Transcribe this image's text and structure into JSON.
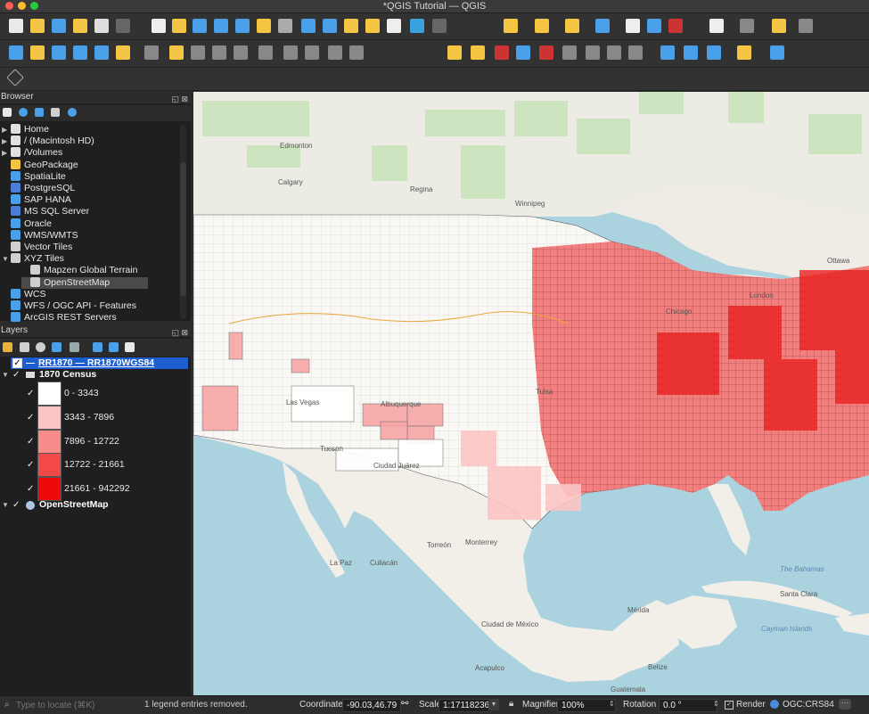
{
  "window": {
    "title": "*QGIS Tutorial — QGIS"
  },
  "browser": {
    "title": "Browser",
    "items": [
      {
        "label": "Home",
        "icon": "folder-home-icon"
      },
      {
        "label": "/ (Macintosh HD)",
        "icon": "folder-icon"
      },
      {
        "label": "/Volumes",
        "icon": "folder-icon"
      },
      {
        "label": "GeoPackage",
        "icon": "geopackage-icon"
      },
      {
        "label": "SpatiaLite",
        "icon": "spatialite-icon"
      },
      {
        "label": "PostgreSQL",
        "icon": "postgresql-icon"
      },
      {
        "label": "SAP HANA",
        "icon": "sap-hana-icon"
      },
      {
        "label": "MS SQL Server",
        "icon": "mssql-icon"
      },
      {
        "label": "Oracle",
        "icon": "oracle-icon"
      },
      {
        "label": "WMS/WMTS",
        "icon": "wms-icon"
      },
      {
        "label": "Vector Tiles",
        "icon": "vector-tiles-icon"
      },
      {
        "label": "XYZ Tiles",
        "icon": "xyz-tiles-icon"
      },
      {
        "label": "Mapzen Global Terrain",
        "icon": "tile-layer-icon"
      },
      {
        "label": "OpenStreetMap",
        "icon": "tile-layer-icon"
      },
      {
        "label": "WCS",
        "icon": "wcs-icon"
      },
      {
        "label": "WFS / OGC API - Features",
        "icon": "wfs-icon"
      },
      {
        "label": "ArcGIS REST Servers",
        "icon": "arcgis-icon"
      }
    ]
  },
  "layers": {
    "title": "Layers",
    "rr_layer": "RR1870 — RR1870WGS84",
    "census_layer": "1870 Census",
    "osm_layer": "OpenStreetMap",
    "legend": [
      {
        "label": "0 - 3343",
        "color": "#ffffff"
      },
      {
        "label": "3343 - 7896",
        "color": "#fbc4c4"
      },
      {
        "label": "7896 - 12722",
        "color": "#f88a8a"
      },
      {
        "label": "12722 - 21661",
        "color": "#f34848"
      },
      {
        "label": "21661 - 942292",
        "color": "#ee0a0a"
      }
    ]
  },
  "map": {
    "places": [
      {
        "name": "Edmonton",
        "kind": "city"
      },
      {
        "name": "Calgary",
        "kind": "city"
      },
      {
        "name": "Regina",
        "kind": "city"
      },
      {
        "name": "Winnipeg",
        "kind": "city"
      },
      {
        "name": "Ottawa",
        "kind": "city"
      },
      {
        "name": "London",
        "kind": "city"
      },
      {
        "name": "Chicago",
        "kind": "city"
      },
      {
        "name": "Las Vegas",
        "kind": "city"
      },
      {
        "name": "Albuquerque",
        "kind": "city"
      },
      {
        "name": "Tucson",
        "kind": "city"
      },
      {
        "name": "Ciudad Juárez",
        "kind": "city"
      },
      {
        "name": "Tulsa",
        "kind": "city"
      },
      {
        "name": "Monterrey",
        "kind": "city"
      },
      {
        "name": "Torreón",
        "kind": "city"
      },
      {
        "name": "Culiacán",
        "kind": "city"
      },
      {
        "name": "La Paz",
        "kind": "city"
      },
      {
        "name": "Ciudad de México",
        "kind": "city"
      },
      {
        "name": "Acapulco",
        "kind": "city"
      },
      {
        "name": "Mérida",
        "kind": "city"
      },
      {
        "name": "Belize",
        "kind": "city"
      },
      {
        "name": "Guatemala",
        "kind": "city"
      },
      {
        "name": "The Bahamas",
        "kind": "city"
      },
      {
        "name": "Santa Clara",
        "kind": "city"
      },
      {
        "name": "Cayman Islands",
        "kind": "city"
      }
    ]
  },
  "status": {
    "locate_placeholder": "Type to locate (⌘K)",
    "message": "1 legend entries removed.",
    "coordinate_label": "Coordinate",
    "coordinate_value": "-90.03,46.79",
    "scale_label": "Scale",
    "scale_value": "1:17118236",
    "magnifier_label": "Magnifier",
    "magnifier_value": "100%",
    "rotation_label": "Rotation",
    "rotation_value": "0.0 °",
    "render_label": "Render",
    "crs_label": "OGC:CRS84"
  }
}
